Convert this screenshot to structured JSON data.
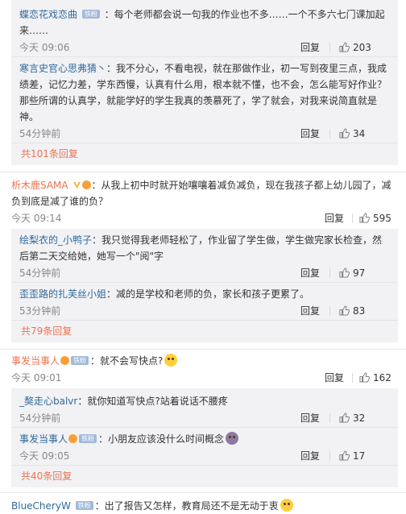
{
  "thread1": {
    "replies": [
      {
        "user": "蝶恋花戏恋曲",
        "badge": "铁粉",
        "text": "：每个老师都会说一句我的作业也不多……一个不多六七门课加起来……",
        "time": "今天 09:06",
        "reply_label": "回复",
        "likes": "203"
      },
      {
        "user": "寒言史官心思弗猜丶",
        "text": "：我不分心，不看电视，就在那做作业，初一写到夜里三点，我成绩差，记忆力差，学东西慢，认真有什么用，根本就不懂，也不会，怎么能写好作业？那些所谓的认真学，就能学好的学生我真的羡慕死了，学了就会，对我来说简直就是神。",
        "time": "54分钟前",
        "reply_label": "回复",
        "likes": "34"
      }
    ],
    "more": "共101条回复"
  },
  "thread2": {
    "user": "析木鹿SAMA",
    "text": "：从我上初中时就开始嚷嚷着减负减负，现在我孩子都上幼儿园了，减负到底是减了谁的负？",
    "time": "今天 09:14",
    "reply_label": "回复",
    "likes": "595",
    "replies": [
      {
        "user": "绘梨衣的_小鸭子",
        "text": "：我只觉得我老师轻松了，作业留了学生做，学生做完家长检查，然后第二天交给她，她写一个\"阅\"字",
        "time": "54分钟前",
        "reply_label": "回复",
        "likes": "97"
      },
      {
        "user": "歪歪路的扎芙丝小姐",
        "text": "：减的是学校和老师的负，家长和孩子更累了。",
        "time": "53分钟前",
        "reply_label": "回复",
        "likes": "83"
      }
    ],
    "more": "共79条回复"
  },
  "thread3": {
    "user": "事发当事人",
    "badge": "铁粉",
    "text": "：就不会写快点?",
    "time": "今天 09:01",
    "reply_label": "回复",
    "likes": "162",
    "replies": [
      {
        "user": "_獒走心balvr",
        "text": "：就你知道写快点?站着说话不腰疼",
        "time": "54分钟前",
        "reply_label": "回复",
        "likes": "32"
      },
      {
        "user": "事发当事人",
        "badge": "铁粉",
        "text": "：小朋友应该没什么时间概念",
        "time": "今天 09:05",
        "reply_label": "回复",
        "likes": "17"
      }
    ],
    "more": "共40条回复"
  },
  "thread4": {
    "user": "BlueCheryW",
    "badge": "铁粉",
    "text": "：出了报告又怎样，教育局还不是无动于衷"
  },
  "colors": {
    "username": "#eb7350",
    "link": "#2f6a9c",
    "reply_box": "#f2f2f5"
  },
  "icons": [
    "thumbs-up-icon",
    "verified-v-icon",
    "crown-icon",
    "emoji-icon"
  ]
}
